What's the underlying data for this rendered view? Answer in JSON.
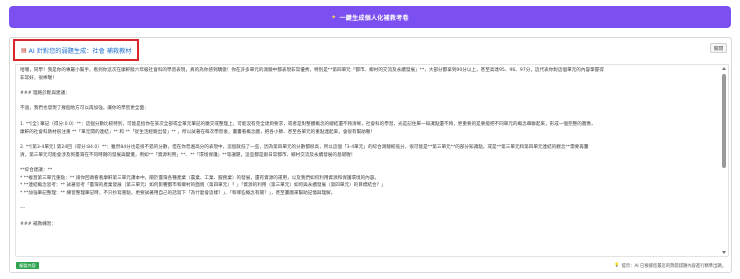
{
  "top_button": {
    "label": "一鍵生成個人化補救考卷",
    "icon": "sparkle-icon"
  },
  "card": {
    "title": "AI 針對您的弱題生成：社會 補救教材",
    "title_icon": "document-icon",
    "close_label": "關閉",
    "content_lines": [
      "哈囉，同學！我是你的專屬小幫手，看到你這次在康軒版六年級社會科的學習表現，真的為你感到驕傲！你在許多單元的測驗中都表現非常優秀，特別是**第四單元「都市、鄉村的交流及永續發展」**，大部分都拿到90分以上，甚至高達95、96、97分，這代表你對這個單元的內容掌握得",
      "非常好，很棒喔！",
      "",
      "### 理路診斷與建議：",
      "",
      "不過，我們也發現了幾個地方可以再加強，讓你的學習更全面：",
      "",
      "1.  **[全] 筆記（得分:0.0）**：這個分數比較特別，可能是指你在某次全部或全單元筆記的繳交或整理上，可能沒有完全達到要求，或者是對整體概念的總結還不夠清晰，社會科的學習，光是記住單一知識點還不夠，更重要的是要能把不同單元的概念串聯起來，形成一個完整的圖像，",
      "康軒的社會科教材很注重 **「單元間的連結」** 和 **「從生活經驗出發」** ，所以試著在每次學習後，畫畫看概念圖，把各小節、甚至各單元的重點連起來，會很有幫助喔！",
      "",
      "2.  **[第3-4單元] 第24回（得分:84.0）**：雖然84分也是很不錯的分數，但在你普遍高分的表現中，這個就低了一些，因為第四單元的分數都很高，所以這個「3-4單元」的綜合測驗較低分，很可能是**第三單元**的部分知識點，或是**第三單元和第四單元連結的觀念**需要再釐",
      "清，第三單元可能會涉及到臺灣在不同時期的發展與變遷，例如**「資源利用」**、**「環境保護」**等議題，這些都是跟日常都市、鄉村交流及永續發展的基礎喔！",
      "",
      "**綜合建議：**",
      "*   **複習第三單元重點：** 請你回頭看看康軒第三單元課本中，關於臺灣各種產業（農業、工業、服務業）的發展，還有資源的運用，以及我們如何利用資源和保護環境的內容。",
      "*   **連結概念思考：** 試著思考「臺灣的產業發展（第三單元）如何影響都市和鄉村的面貌（第四單元）？」「資源的利用（第三單元）如何與永續發展（第四單元）的目標結合？」",
      "*   **加強筆記整理：** 練習整理筆記時，不只抄寫重點，更要試著用自己的話寫下「為什麼會這樣？」、「和哪些概念有關？」，甚至畫圖來幫助記憶與理解。",
      "",
      "---",
      "",
      "### 補救練習：",
      ""
    ]
  },
  "footer": {
    "badge": "複製內容",
    "hint": "提示：AI 已根據您最近的弊錯錯題內容進行精準出題。",
    "hint_icon": "lightbulb-icon"
  },
  "colors": {
    "primary": "#7b4ff0",
    "title_text": "#1f6fd0",
    "highlight_border": "#d8262a",
    "badge_green": "#2ea44f"
  }
}
